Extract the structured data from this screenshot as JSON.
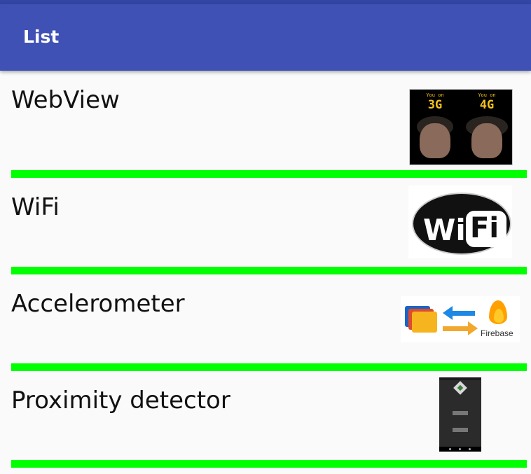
{
  "appbar": {
    "title": "List"
  },
  "items": [
    {
      "label": "WebView",
      "image": "3g-vs-4g-image",
      "image_text": {
        "left_small": "You on",
        "left_big": "3G",
        "right_small": "You on",
        "right_big": "4G"
      }
    },
    {
      "label": "WiFi",
      "image": "wifi-logo-image",
      "image_text": {
        "wi": "Wi",
        "fi": "Fi"
      }
    },
    {
      "label": "Accelerometer",
      "image": "folders-to-firebase-image",
      "image_text": {
        "brand": "Firebase"
      }
    },
    {
      "label": "Proximity detector",
      "image": "app-screenshot-image"
    }
  ],
  "colors": {
    "appbar": "#3f51b5",
    "divider": "#00ff00",
    "background": "#fafafa"
  }
}
